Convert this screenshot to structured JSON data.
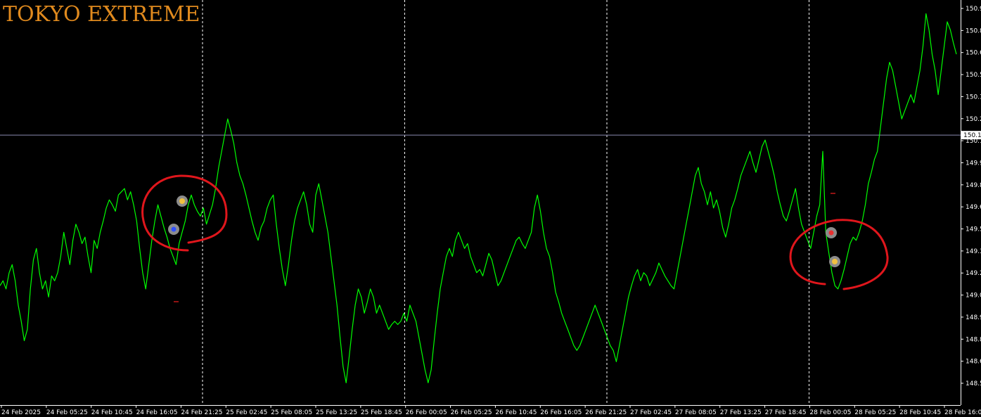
{
  "window": {
    "title": "TOKYO EXTREME"
  },
  "colors": {
    "background": "#000000",
    "price_line": "#00ff00",
    "grid": "#ffffff",
    "axis": "#ffffff",
    "title": "#e08a1e",
    "current_price_line": "#8a8ab0",
    "annotation": "#e0161c",
    "marker_ring": "#8c8c8c"
  },
  "chart_data": {
    "type": "line",
    "title": "TOKYO EXTREME",
    "ylim": [
      148.5,
      150.95
    ],
    "y_ticks": [
      "150.9",
      "150.8",
      "150.6",
      "150.5",
      "150.3",
      "150.2",
      "150.1",
      "149.9",
      "149.8",
      "149.6",
      "149.5",
      "149.3",
      "149.2",
      "149.0",
      "148.9",
      "148.8",
      "148.6",
      "148.5"
    ],
    "x_ticks": [
      "24 Feb 2025",
      "24 Feb 05:25",
      "24 Feb 10:45",
      "24 Feb 16:05",
      "24 Feb 21:25",
      "25 Feb 02:45",
      "25 Feb 08:05",
      "25 Feb 13:25",
      "25 Feb 18:45",
      "26 Feb 00:05",
      "26 Feb 05:25",
      "26 Feb 10:45",
      "26 Feb 16:05",
      "26 Feb 21:25",
      "27 Feb 02:45",
      "27 Feb 08:05",
      "27 Feb 13:25",
      "27 Feb 18:45",
      "28 Feb 00:05",
      "28 Feb 05:25",
      "28 Feb 10:45",
      "28 Feb 16:05"
    ],
    "day_separators": [
      "25 Feb 00:00",
      "26 Feb 00:00",
      "27 Feb 00:00",
      "28 Feb 00:00"
    ],
    "current_price": {
      "value": 150.15,
      "label": "150.1"
    },
    "grid": false,
    "series": [
      {
        "values": [
          149.22,
          149.25,
          149.2,
          149.3,
          149.35,
          149.25,
          149.1,
          149.0,
          148.88,
          148.95,
          149.2,
          149.38,
          149.45,
          149.3,
          149.2,
          149.25,
          149.15,
          149.28,
          149.25,
          149.3,
          149.4,
          149.55,
          149.45,
          149.35,
          149.5,
          149.6,
          149.55,
          149.48,
          149.52,
          149.4,
          149.3,
          149.5,
          149.45,
          149.55,
          149.62,
          149.7,
          149.75,
          149.72,
          149.68,
          149.78,
          149.8,
          149.82,
          149.75,
          149.8,
          149.72,
          149.62,
          149.45,
          149.3,
          149.2,
          149.35,
          149.5,
          149.62,
          149.72,
          149.65,
          149.58,
          149.52,
          149.45,
          149.4,
          149.35,
          149.48,
          149.55,
          149.62,
          149.72,
          149.78,
          149.72,
          149.68,
          149.65,
          149.7,
          149.6,
          149.66,
          149.72,
          149.82,
          149.95,
          150.05,
          150.15,
          150.25,
          150.18,
          150.1,
          149.98,
          149.9,
          149.85,
          149.78,
          149.7,
          149.62,
          149.55,
          149.5,
          149.58,
          149.62,
          149.7,
          149.75,
          149.78,
          149.6,
          149.45,
          149.32,
          149.22,
          149.35,
          149.5,
          149.62,
          149.7,
          149.75,
          149.8,
          149.72,
          149.6,
          149.55,
          149.78,
          149.85,
          149.75,
          149.65,
          149.55,
          149.4,
          149.25,
          149.1,
          148.9,
          148.72,
          148.62,
          148.78,
          148.95,
          149.1,
          149.2,
          149.15,
          149.05,
          149.12,
          149.2,
          149.15,
          149.05,
          149.1,
          149.05,
          149.0,
          148.95,
          148.98,
          149.0,
          148.98,
          149.0,
          149.05,
          149.0,
          149.1,
          149.05,
          149.0,
          148.9,
          148.8,
          148.7,
          148.62,
          148.7,
          148.88,
          149.05,
          149.2,
          149.3,
          149.4,
          149.45,
          149.4,
          149.5,
          149.55,
          149.5,
          149.45,
          149.48,
          149.4,
          149.35,
          149.3,
          149.32,
          149.28,
          149.35,
          149.42,
          149.38,
          149.3,
          149.22,
          149.25,
          149.3,
          149.35,
          149.4,
          149.45,
          149.5,
          149.52,
          149.48,
          149.45,
          149.5,
          149.55,
          149.7,
          149.78,
          149.68,
          149.55,
          149.45,
          149.4,
          149.3,
          149.18,
          149.12,
          149.05,
          149.0,
          148.95,
          148.9,
          148.85,
          148.82,
          148.85,
          148.9,
          148.95,
          149.0,
          149.05,
          149.1,
          149.05,
          149.0,
          148.95,
          148.9,
          148.85,
          148.82,
          148.75,
          148.85,
          148.95,
          149.05,
          149.15,
          149.22,
          149.28,
          149.32,
          149.25,
          149.3,
          149.28,
          149.22,
          149.26,
          149.3,
          149.36,
          149.32,
          149.28,
          149.25,
          149.22,
          149.2,
          149.3,
          149.4,
          149.5,
          149.6,
          149.7,
          149.8,
          149.9,
          149.95,
          149.85,
          149.8,
          149.72,
          149.8,
          149.7,
          149.75,
          149.68,
          149.58,
          149.52,
          149.6,
          149.7,
          149.75,
          149.82,
          149.9,
          149.95,
          150.0,
          150.05,
          149.98,
          149.92,
          150.0,
          150.08,
          150.12,
          150.05,
          149.98,
          149.9,
          149.8,
          149.72,
          149.65,
          149.62,
          149.68,
          149.75,
          149.82,
          149.7,
          149.6,
          149.55,
          149.5,
          149.45,
          149.55,
          149.65,
          149.72,
          150.05,
          149.55,
          149.42,
          149.3,
          149.22,
          149.2,
          149.25,
          149.32,
          149.4,
          149.48,
          149.52,
          149.5,
          149.55,
          149.62,
          149.72,
          149.85,
          149.92,
          150.0,
          150.05,
          150.2,
          150.35,
          150.5,
          150.6,
          150.55,
          150.45,
          150.35,
          150.25,
          150.3,
          150.35,
          150.4,
          150.35,
          150.45,
          150.55,
          150.7,
          150.9,
          150.8,
          150.65,
          150.55,
          150.4,
          150.55,
          150.7,
          150.85,
          150.8,
          150.72,
          150.65
        ]
      }
    ]
  }
}
